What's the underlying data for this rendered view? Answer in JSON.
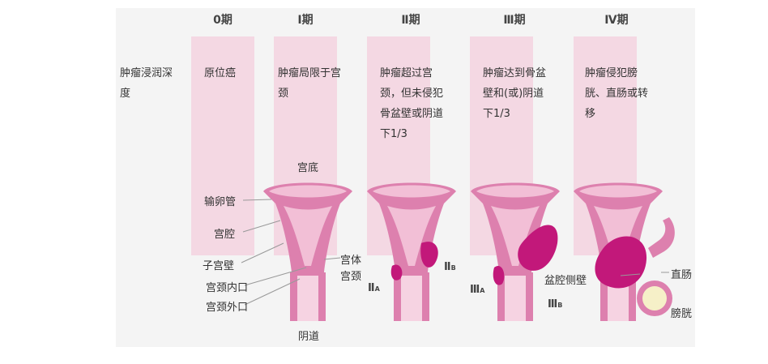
{
  "row_label": "肿瘤浸润深度",
  "stages": [
    {
      "label": "0期",
      "desc": "原位癌"
    },
    {
      "label": "Ⅰ期",
      "desc": "肿瘤局限于宫颈"
    },
    {
      "label": "Ⅱ期",
      "desc": "肿瘤超过宫颈，但未侵犯骨盆壁或阴道下1/3"
    },
    {
      "label": "Ⅲ期",
      "desc": "肿瘤达到骨盆壁和(或)阴道下1/3"
    },
    {
      "label": "Ⅳ期",
      "desc": "肿瘤侵犯膀胱、直肠或转移"
    }
  ],
  "anatomy": {
    "fundus": "宫底",
    "tube": "输卵管",
    "cavity": "宫腔",
    "wall": "子宫壁",
    "internal_os": "宫颈内口",
    "external_os": "宫颈外口",
    "vagina": "阴道",
    "body": "宫体",
    "cervix": "宫颈",
    "pelvic_wall": "盆腔侧壁",
    "rectum": "直肠",
    "bladder": "膀胱"
  },
  "substages": {
    "IIA": {
      "main": "Ⅱ",
      "sub": "A"
    },
    "IIB": {
      "main": "Ⅱ",
      "sub": "B"
    },
    "IIIA": {
      "main": "Ⅲ",
      "sub": "A"
    },
    "IIIB": {
      "main": "Ⅲ",
      "sub": "B"
    }
  },
  "colors": {
    "column_bg": "#f4d8e3",
    "uterus": "#dd80ae",
    "uterus_light": "#f2bfd6",
    "tumor": "#c2187a"
  }
}
